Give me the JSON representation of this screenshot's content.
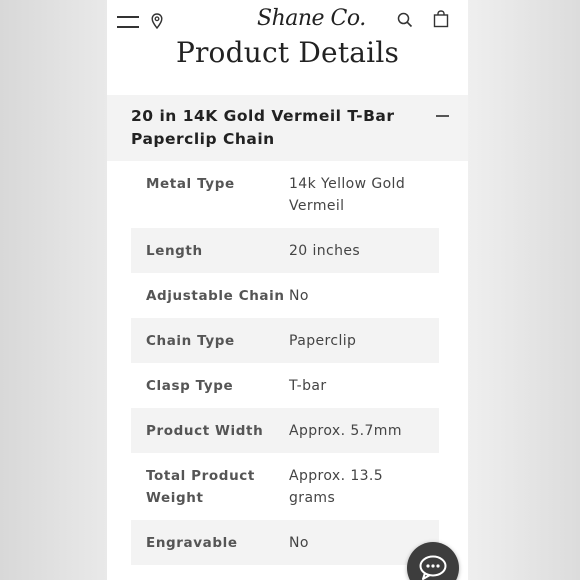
{
  "header": {
    "logo_text": "Shane Co.",
    "page_title": "Product Details"
  },
  "icons": [
    "menu-icon",
    "location-pin-icon",
    "search-icon",
    "shopping-bag-icon",
    "minus-icon",
    "chat-icon"
  ],
  "accordion": {
    "title": "20 in 14K Gold Vermeil T-Bar Paperclip Chain"
  },
  "specs": [
    {
      "label": "Metal Type",
      "value": "14k Yellow Gold Vermeil"
    },
    {
      "label": "Length",
      "value": "20 inches"
    },
    {
      "label": "Adjustable Chain",
      "value": "No"
    },
    {
      "label": "Chain Type",
      "value": "Paperclip"
    },
    {
      "label": "Clasp Type",
      "value": "T-bar"
    },
    {
      "label": "Product Width",
      "value": "Approx. 5.7mm"
    },
    {
      "label": "Total Product Weight",
      "value": "Approx. 13.5 grams"
    },
    {
      "label": "Engravable",
      "value": "No"
    }
  ],
  "colors": {
    "row_shade": "#f3f3f3",
    "text_dark": "#222222",
    "text_label": "#555555",
    "chat_button": "#3d3d3d"
  }
}
